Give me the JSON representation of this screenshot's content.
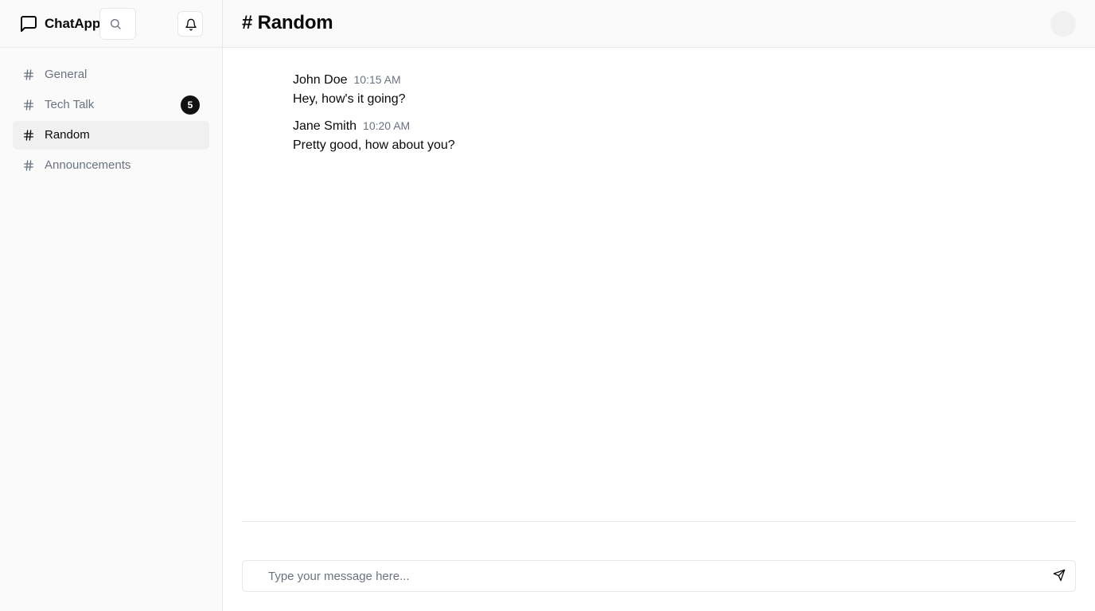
{
  "app": {
    "name": "ChatApp"
  },
  "icons": {
    "logo": "message-square-icon",
    "search": "search-icon",
    "notifications": "bell-icon",
    "channel": "hash-icon",
    "send": "send-icon"
  },
  "colors": {
    "accent": "#111111",
    "muted_text": "#6b7280",
    "active_bg": "#f0f0f1",
    "border": "#e5e7eb"
  },
  "sidebar": {
    "channels": [
      {
        "label": "General",
        "badge": null,
        "active": false
      },
      {
        "label": "Tech Talk",
        "badge": "5",
        "active": false
      },
      {
        "label": "Random",
        "badge": null,
        "active": true
      },
      {
        "label": "Announcements",
        "badge": null,
        "active": false
      }
    ]
  },
  "header": {
    "title": "# Random"
  },
  "messages": [
    {
      "author": "John Doe",
      "time": "10:15 AM",
      "text": "Hey, how's it going?"
    },
    {
      "author": "Jane Smith",
      "time": "10:20 AM",
      "text": "Pretty good, how about you?"
    }
  ],
  "composer": {
    "placeholder": "Type your message here...",
    "value": ""
  }
}
